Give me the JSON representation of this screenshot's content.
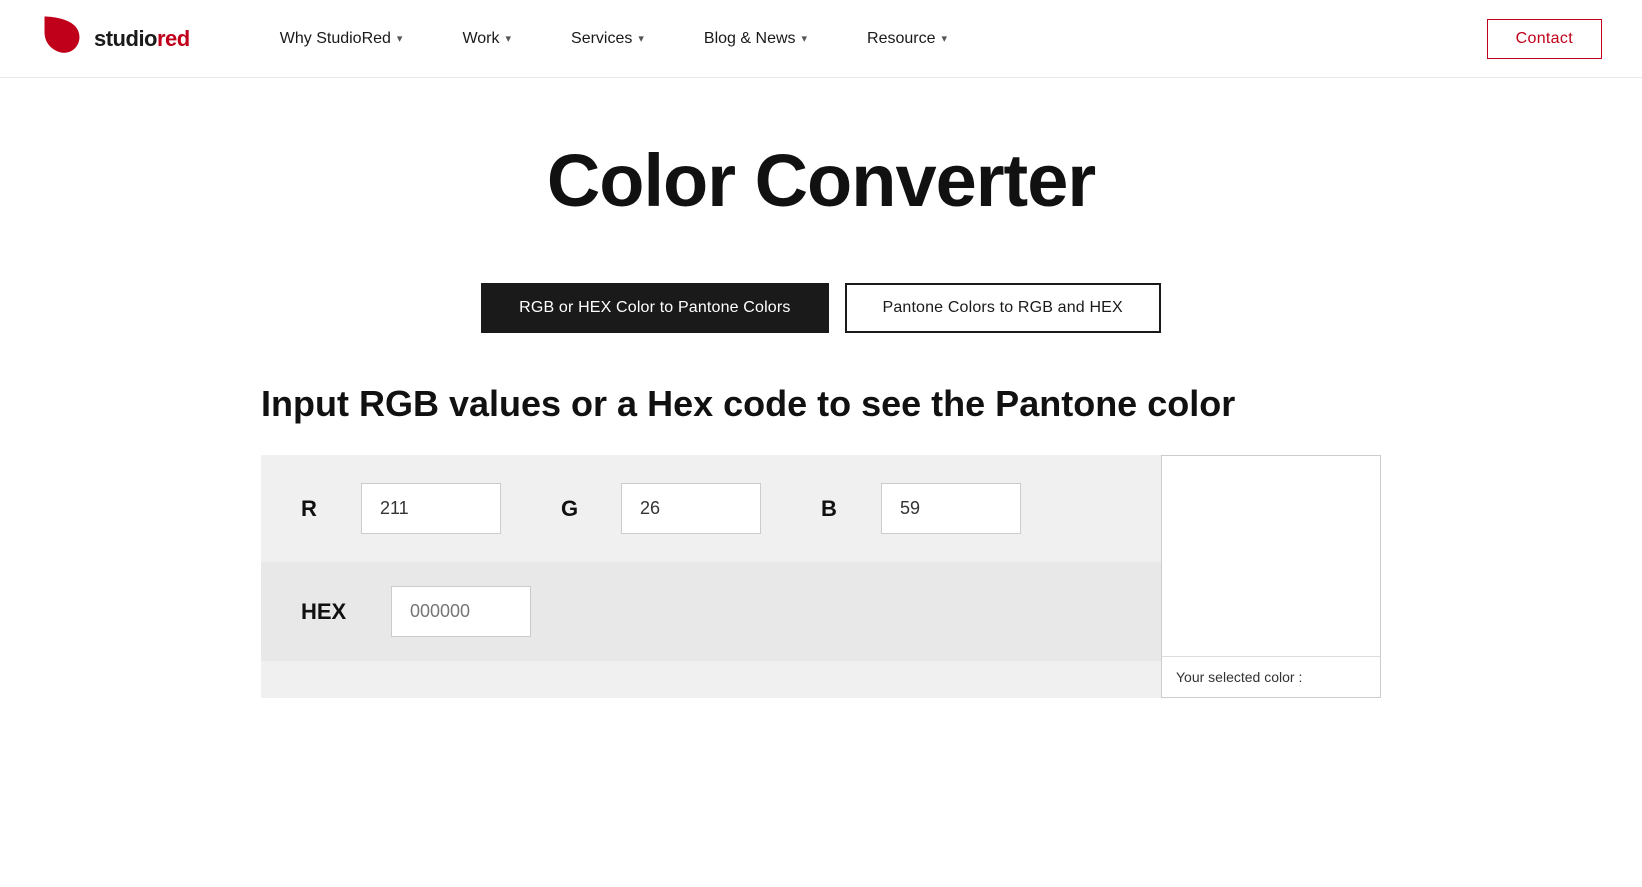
{
  "logo": {
    "text": "studiored"
  },
  "nav": {
    "items": [
      {
        "label": "Why StudioRed",
        "hasDropdown": true
      },
      {
        "label": "Work",
        "hasDropdown": true
      },
      {
        "label": "Services",
        "hasDropdown": true
      },
      {
        "label": "Blog & News",
        "hasDropdown": true
      },
      {
        "label": "Resource",
        "hasDropdown": true
      }
    ],
    "contact_label": "Contact"
  },
  "page": {
    "title": "Color Converter",
    "subtitle": "Input RGB values or a Hex code to see the Pantone color"
  },
  "tabs": [
    {
      "label": "RGB or HEX Color to Pantone Colors",
      "active": true
    },
    {
      "label": "Pantone Colors to RGB and HEX",
      "active": false
    }
  ],
  "inputs": {
    "r_label": "R",
    "r_value": "211",
    "g_label": "G",
    "g_value": "26",
    "b_label": "B",
    "b_value": "59",
    "hex_label": "HEX",
    "hex_value": "000000",
    "hex_placeholder": "000000"
  },
  "preview": {
    "selected_color_label": "Your selected color :"
  }
}
